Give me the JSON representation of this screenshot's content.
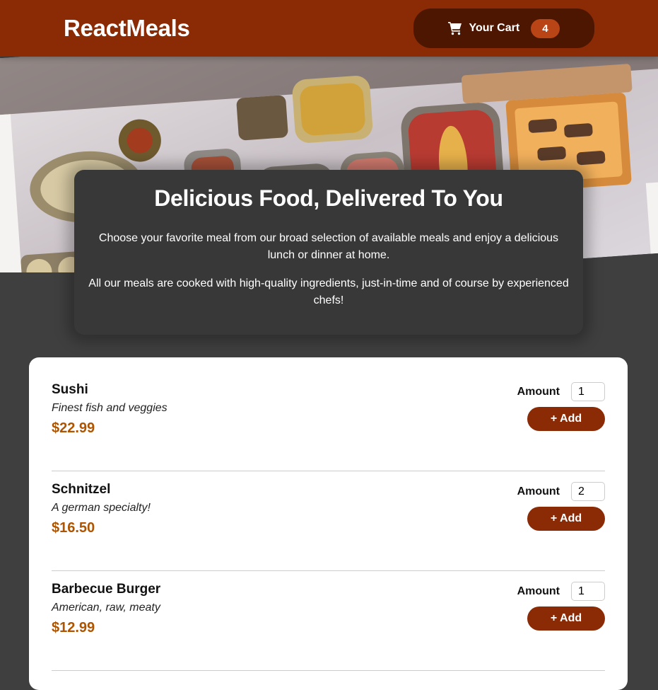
{
  "header": {
    "logo": "ReactMeals",
    "cart_label": "Your Cart",
    "cart_count": "4",
    "cart_icon": "shopping-cart-icon"
  },
  "summary": {
    "title": "Delicious Food, Delivered To You",
    "paragraph1": "Choose your favorite meal from our broad selection of available meals and enjoy a delicious lunch or dinner at home.",
    "paragraph2": "All our meals are cooked with high-quality ingredients, just-in-time and of course by experienced chefs!"
  },
  "meals": [
    {
      "name": "Sushi",
      "description": "Finest fish and veggies",
      "price": "$22.99",
      "amount_label": "Amount",
      "amount": "1",
      "add_label": "+ Add"
    },
    {
      "name": "Schnitzel",
      "description": "A german specialty!",
      "price": "$16.50",
      "amount_label": "Amount",
      "amount": "2",
      "add_label": "+ Add"
    },
    {
      "name": "Barbecue Burger",
      "description": "American, raw, meaty",
      "price": "$12.99",
      "amount_label": "Amount",
      "amount": "1",
      "add_label": "+ Add"
    }
  ],
  "colors": {
    "header_bg": "#8a2b06",
    "cart_bg": "#4d1601",
    "badge_bg": "#b94517",
    "price": "#ad5502",
    "page_bg": "#3f3f3f",
    "summary_bg": "#383838"
  }
}
